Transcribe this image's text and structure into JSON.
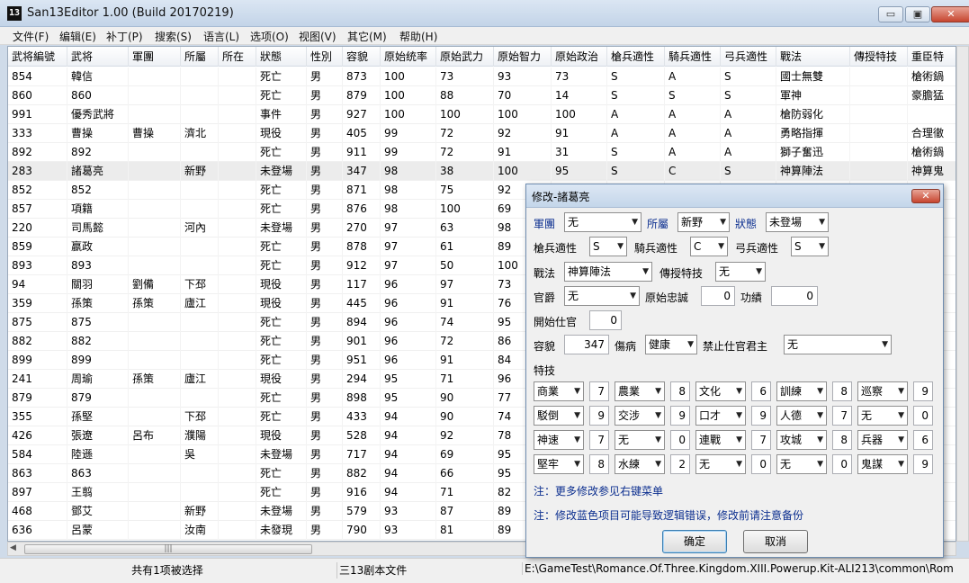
{
  "window": {
    "icon_text": "13",
    "title": "San13Editor 1.00 (Build 20170219)",
    "minimize_glyph": "▭",
    "maximize_glyph": "▣",
    "close_glyph": "✕"
  },
  "menu": [
    "文件(F)",
    "编辑(E)",
    "补丁(P)",
    "搜索(S)",
    "语言(L)",
    "选项(O)",
    "视图(V)",
    "其它(M)",
    "帮助(H)"
  ],
  "table": {
    "columns": [
      "武将編號",
      "武将",
      "軍團",
      "所屬",
      "所在",
      "狀態",
      "性別",
      "容貌",
      "原始统率",
      "原始武力",
      "原始智力",
      "原始政治",
      "槍兵適性",
      "騎兵適性",
      "弓兵適性",
      "戰法",
      "傳授特技",
      "重臣特"
    ],
    "rows": [
      [
        "854",
        "韓信",
        "",
        "",
        "",
        "死亡",
        "男",
        "873",
        "100",
        "73",
        "93",
        "73",
        "S",
        "A",
        "S",
        "國士無雙",
        "",
        "槍術鍋"
      ],
      [
        "860",
        "860",
        "",
        "",
        "",
        "死亡",
        "男",
        "879",
        "100",
        "88",
        "70",
        "14",
        "S",
        "S",
        "S",
        "軍神",
        "",
        "豪膽猛"
      ],
      [
        "991",
        "優秀武將",
        "",
        "",
        "",
        "事件",
        "男",
        "927",
        "100",
        "100",
        "100",
        "100",
        "A",
        "A",
        "A",
        "槍防弱化",
        "",
        ""
      ],
      [
        "333",
        "曹操",
        "曹操",
        "濟北",
        "",
        "現役",
        "男",
        "405",
        "99",
        "72",
        "92",
        "91",
        "A",
        "A",
        "A",
        "勇略指揮",
        "",
        "合理徹"
      ],
      [
        "892",
        "892",
        "",
        "",
        "",
        "死亡",
        "男",
        "911",
        "99",
        "72",
        "91",
        "31",
        "S",
        "A",
        "A",
        "獅子奮迅",
        "",
        "槍術鍋"
      ],
      [
        "283",
        "諸葛亮",
        "",
        "新野",
        "",
        "未登場",
        "男",
        "347",
        "98",
        "38",
        "100",
        "95",
        "S",
        "C",
        "S",
        "神算陣法",
        "",
        "神算鬼"
      ],
      [
        "852",
        "852",
        "",
        "",
        "",
        "死亡",
        "男",
        "871",
        "98",
        "75",
        "92",
        "",
        "",
        "",
        "",
        "",
        "",
        ""
      ],
      [
        "857",
        "項籍",
        "",
        "",
        "",
        "死亡",
        "男",
        "876",
        "98",
        "100",
        "69",
        "",
        "",
        "",
        "",
        "",
        "",
        ""
      ],
      [
        "220",
        "司馬懿",
        "",
        "河內",
        "",
        "未登場",
        "男",
        "270",
        "97",
        "63",
        "98",
        "",
        "",
        "",
        "",
        "",
        "",
        ""
      ],
      [
        "859",
        "嬴政",
        "",
        "",
        "",
        "死亡",
        "男",
        "878",
        "97",
        "61",
        "89",
        "",
        "",
        "",
        "",
        "",
        "",
        ""
      ],
      [
        "893",
        "893",
        "",
        "",
        "",
        "死亡",
        "男",
        "912",
        "97",
        "50",
        "100",
        "",
        "",
        "",
        "",
        "",
        "",
        ""
      ],
      [
        "94",
        "關羽",
        "劉備",
        "下邳",
        "",
        "現役",
        "男",
        "117",
        "96",
        "97",
        "73",
        "",
        "",
        "",
        "",
        "",
        "",
        ""
      ],
      [
        "359",
        "孫策",
        "孫策",
        "廬江",
        "",
        "現役",
        "男",
        "445",
        "96",
        "91",
        "76",
        "",
        "",
        "",
        "",
        "",
        "",
        ""
      ],
      [
        "875",
        "875",
        "",
        "",
        "",
        "死亡",
        "男",
        "894",
        "96",
        "74",
        "95",
        "",
        "",
        "",
        "",
        "",
        "",
        ""
      ],
      [
        "882",
        "882",
        "",
        "",
        "",
        "死亡",
        "男",
        "901",
        "96",
        "72",
        "86",
        "",
        "",
        "",
        "",
        "",
        "",
        ""
      ],
      [
        "899",
        "899",
        "",
        "",
        "",
        "死亡",
        "男",
        "951",
        "96",
        "91",
        "84",
        "",
        "",
        "",
        "",
        "",
        "",
        ""
      ],
      [
        "241",
        "周瑜",
        "孫策",
        "廬江",
        "",
        "現役",
        "男",
        "294",
        "95",
        "71",
        "96",
        "",
        "",
        "",
        "",
        "",
        "",
        ""
      ],
      [
        "879",
        "879",
        "",
        "",
        "",
        "死亡",
        "男",
        "898",
        "95",
        "90",
        "77",
        "",
        "",
        "",
        "",
        "",
        "",
        ""
      ],
      [
        "355",
        "孫堅",
        "",
        "下邳",
        "",
        "死亡",
        "男",
        "433",
        "94",
        "90",
        "74",
        "",
        "",
        "",
        "",
        "",
        "",
        ""
      ],
      [
        "426",
        "張遼",
        "呂布",
        "濮陽",
        "",
        "現役",
        "男",
        "528",
        "94",
        "92",
        "78",
        "",
        "",
        "",
        "",
        "",
        "",
        ""
      ],
      [
        "584",
        "陸遜",
        "",
        "吳",
        "",
        "未登場",
        "男",
        "717",
        "94",
        "69",
        "95",
        "",
        "",
        "",
        "",
        "",
        "",
        ""
      ],
      [
        "863",
        "863",
        "",
        "",
        "",
        "死亡",
        "男",
        "882",
        "94",
        "66",
        "95",
        "",
        "",
        "",
        "",
        "",
        "",
        ""
      ],
      [
        "897",
        "王翦",
        "",
        "",
        "",
        "死亡",
        "男",
        "916",
        "94",
        "71",
        "82",
        "",
        "",
        "",
        "",
        "",
        "",
        ""
      ],
      [
        "468",
        "鄧艾",
        "",
        "新野",
        "",
        "未登場",
        "男",
        "579",
        "93",
        "87",
        "89",
        "",
        "",
        "",
        "",
        "",
        "",
        ""
      ],
      [
        "636",
        "呂蒙",
        "",
        "汝南",
        "",
        "未發現",
        "男",
        "790",
        "93",
        "81",
        "89",
        "",
        "",
        "",
        "",
        "",
        "",
        ""
      ]
    ]
  },
  "scroll": {
    "thumb_glyph": "|||",
    "left_glyph": "◀"
  },
  "status": {
    "selection": "共有1项被选择",
    "file_type": "三13剧本文件",
    "path": "E:\\GameTest\\Romance.Of.Three.Kingdom.XIII.Powerup.Kit-ALI213\\common\\Rom"
  },
  "dialog": {
    "title": "修改-諸葛亮",
    "close_glyph": "✕",
    "dropdown_glyph": "▼",
    "labels": {
      "army": "軍團",
      "belong": "所屬",
      "state": "狀態",
      "spear": "槍兵適性",
      "cavalry": "騎兵適性",
      "bow": "弓兵適性",
      "tactic": "戰法",
      "teach": "傳授特技",
      "rank": "官爵",
      "loyalty": "原始忠誠",
      "merit": "功績",
      "start_year": "開始仕官",
      "appearance": "容貌",
      "injury": "傷病",
      "forbid": "禁止仕官君主",
      "skills": "特技"
    },
    "values": {
      "army": "无",
      "belong": "新野",
      "state": "未登場",
      "spear": "S",
      "cavalry": "C",
      "bow": "S",
      "tactic": "神算陣法",
      "teach": "无",
      "rank": "无",
      "loyalty": "0",
      "merit": "0",
      "start_year": "0",
      "appearance": "347",
      "injury": "健康",
      "forbid": "无"
    },
    "skills": [
      [
        {
          "name": "商業",
          "level": "7"
        },
        {
          "name": "農業",
          "level": "8"
        },
        {
          "name": "文化",
          "level": "6"
        },
        {
          "name": "訓練",
          "level": "8"
        },
        {
          "name": "巡察",
          "level": "9"
        }
      ],
      [
        {
          "name": "駁倒",
          "level": "9"
        },
        {
          "name": "交涉",
          "level": "9"
        },
        {
          "name": "口才",
          "level": "9"
        },
        {
          "name": "人德",
          "level": "7"
        },
        {
          "name": "无",
          "level": "0"
        }
      ],
      [
        {
          "name": "神速",
          "level": "7"
        },
        {
          "name": "无",
          "level": "0"
        },
        {
          "name": "連戰",
          "level": "7"
        },
        {
          "name": "攻城",
          "level": "8"
        },
        {
          "name": "兵器",
          "level": "6"
        }
      ],
      [
        {
          "name": "堅牢",
          "level": "8"
        },
        {
          "name": "水練",
          "level": "2"
        },
        {
          "name": "无",
          "level": "0"
        },
        {
          "name": "无",
          "level": "0"
        },
        {
          "name": "鬼謀",
          "level": "9"
        }
      ]
    ],
    "note1": "注：更多修改参见右键菜单",
    "note2": "注：修改蓝色项目可能导致逻辑错误，修改前请注意备份",
    "ok": "确定",
    "cancel": "取消"
  }
}
